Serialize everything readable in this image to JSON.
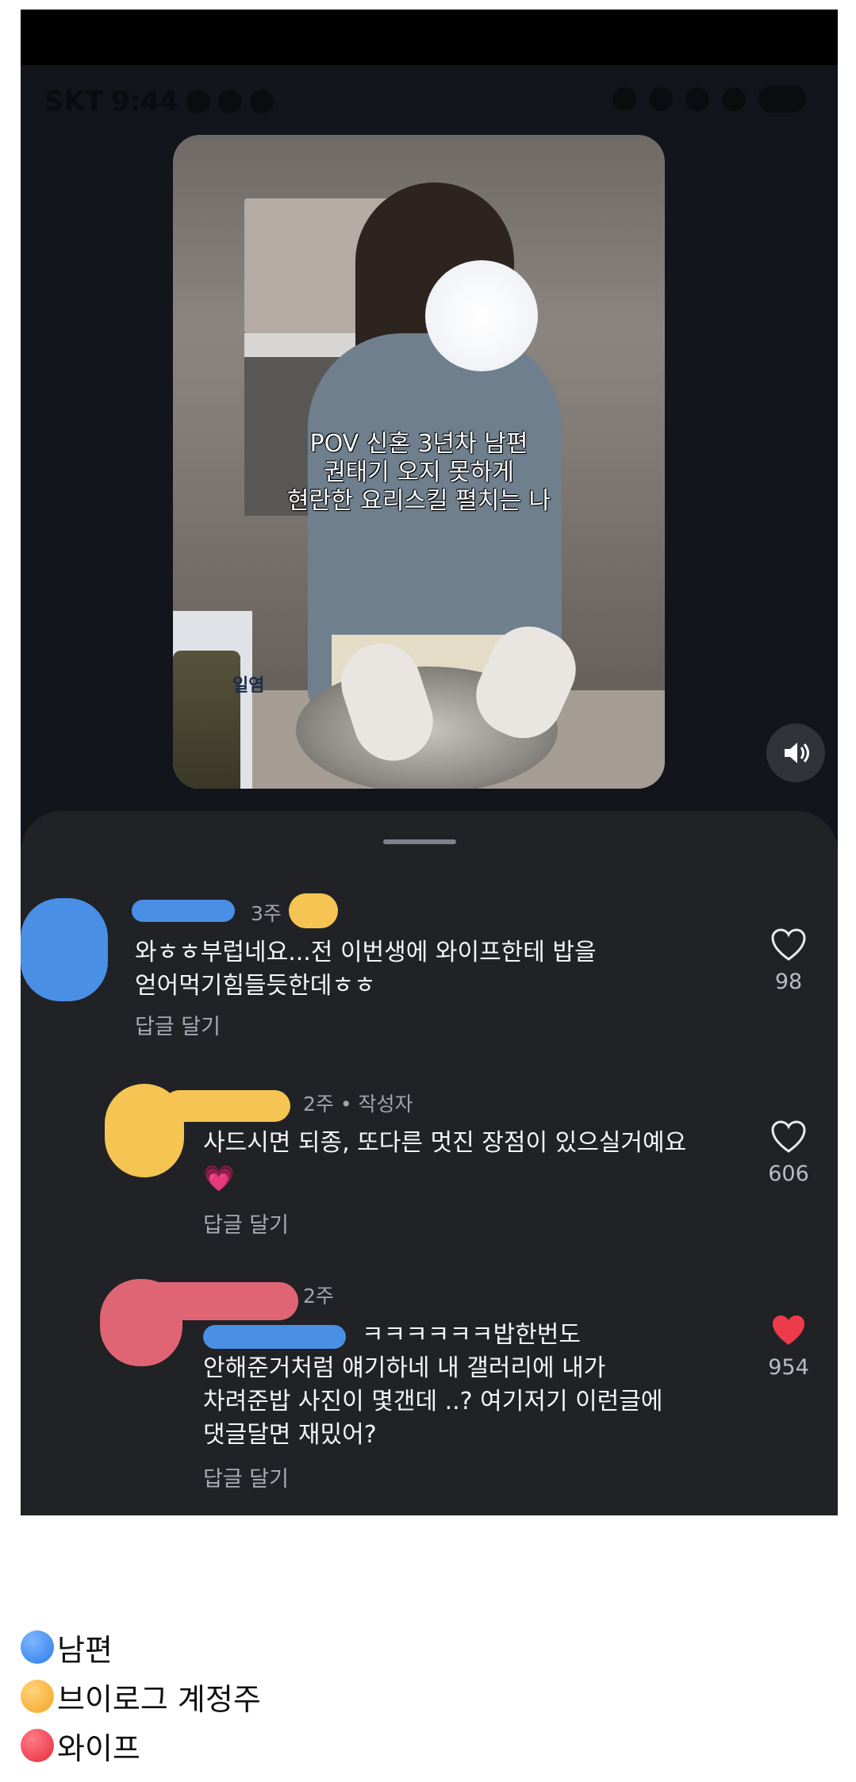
{
  "status_bar": {
    "carrier": "SKT",
    "time": "9:44"
  },
  "video": {
    "caption_lines": [
      "POV 신혼 3년차 남편",
      "권태기 오지 못하게",
      "현란한 요리스킬 펼치는 나"
    ],
    "bag_label": "일염"
  },
  "comments": [
    {
      "time": "3주",
      "body": "와ㅎㅎ부럽네요...전 이번생에 와이프한테 밥을\n얻어먹기힘들듯한데ㅎㅎ",
      "reply_label": "답글 달기",
      "likes": "98",
      "liked": false
    },
    {
      "time": "2주 • 작성자",
      "body": "사드시면 되종, 또다른 멋진 장점이 있으실거예요",
      "emoji": "💗",
      "reply_label": "답글 달기",
      "likes": "606",
      "liked": false
    },
    {
      "time": "2주",
      "body_line1": "ㅋㅋㅋㅋㅋㅋ밥한번도",
      "body": "안해준거처럼 얘기하네 내 갤러리에 내가\n차려준밥 사진이 몇갠데 ..? 여기저기 이런글에\n댓글달면 재밌어?",
      "reply_label": "답글 달기",
      "likes": "954",
      "liked": true
    }
  ],
  "legend": [
    {
      "icon": "blue-circle",
      "color": "#2d7be8",
      "label": "남편"
    },
    {
      "icon": "orange-circle",
      "color": "#f5a623",
      "label": "브이로그 계정주"
    },
    {
      "icon": "red-circle",
      "color": "#e52b3b",
      "label": "와이프"
    }
  ],
  "colors": {
    "like_active": "#ee3b49",
    "sheet_bg": "#202226",
    "blur_blue": "#4a8fe6",
    "blur_yellow": "#f6c452",
    "blur_pink": "#e06574"
  }
}
